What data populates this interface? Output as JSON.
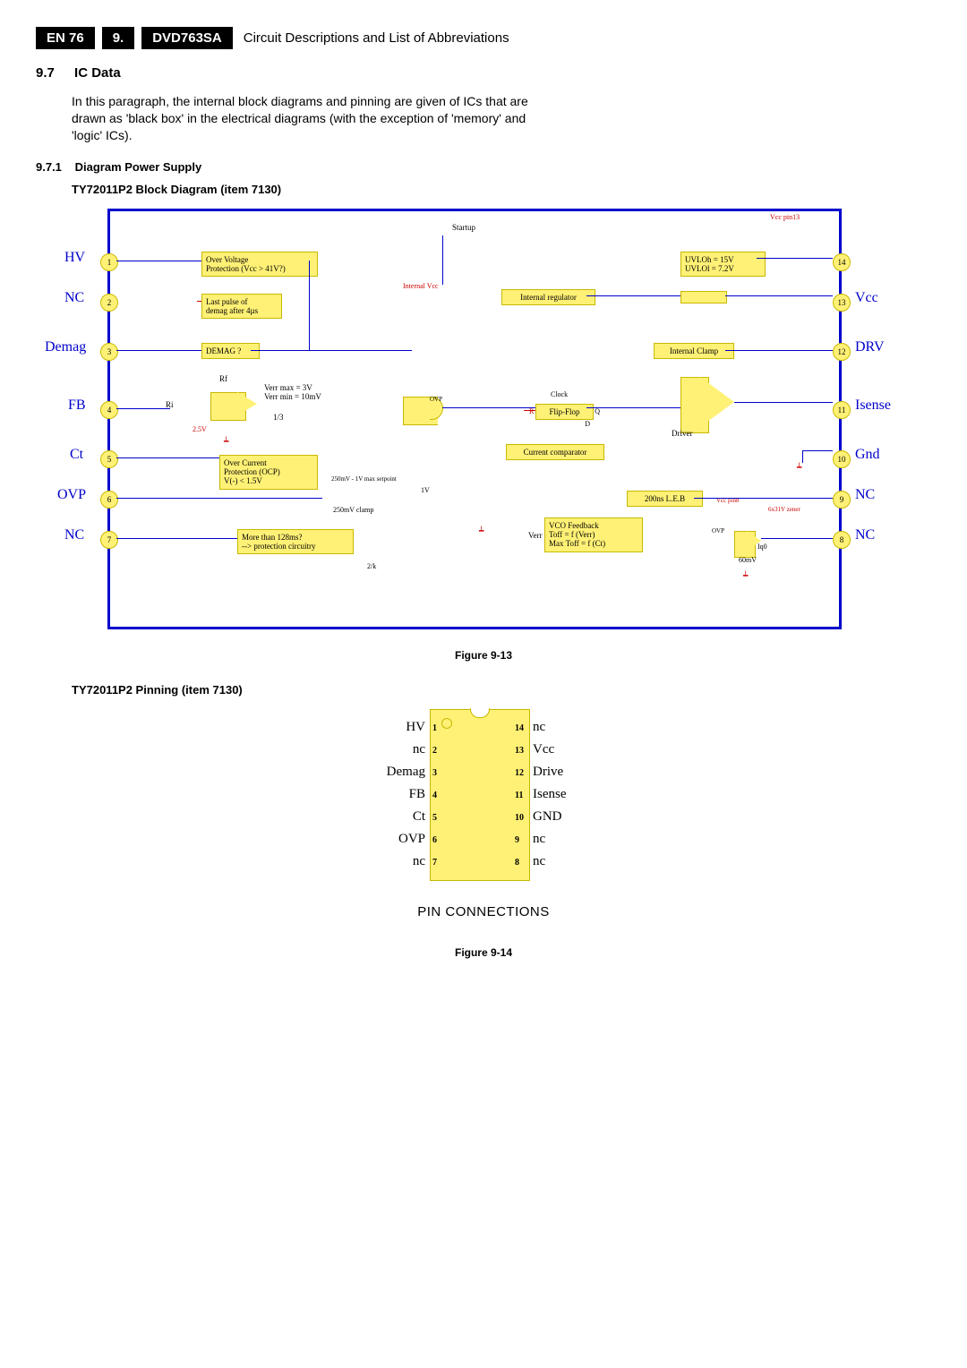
{
  "header": {
    "en": "EN 76",
    "chapnum": "9.",
    "model": "DVD763SA",
    "desc": "Circuit Descriptions and List of Abbreviations"
  },
  "section": {
    "num": "9.7",
    "title": "IC Data"
  },
  "paragraph": "In this paragraph, the internal block diagrams and pinning are given of ICs that are drawn as 'black box' in the electrical diagrams (with the exception of 'memory' and 'logic' ICs).",
  "sub1": {
    "num": "9.7.1",
    "title": "Diagram Power Supply"
  },
  "blocktitle": "TY72011P2 Block Diagram (item 7130)",
  "figure1": "Figure 9-13",
  "pinningtitle": "TY72011P2 Pinning (item 7130)",
  "figure2": "Figure 9-14",
  "d1": {
    "leftpins": [
      {
        "n": "1",
        "label": "HV"
      },
      {
        "n": "2",
        "label": "NC"
      },
      {
        "n": "3",
        "label": "Demag"
      },
      {
        "n": "4",
        "label": "FB"
      },
      {
        "n": "5",
        "label": "Ct"
      },
      {
        "n": "6",
        "label": "OVP"
      },
      {
        "n": "7",
        "label": "NC"
      }
    ],
    "rightpins": [
      {
        "n": "14",
        "label": ""
      },
      {
        "n": "13",
        "label": "Vcc"
      },
      {
        "n": "12",
        "label": "DRV"
      },
      {
        "n": "11",
        "label": "Isense"
      },
      {
        "n": "10",
        "label": "Gnd"
      },
      {
        "n": "9",
        "label": "NC"
      },
      {
        "n": "8",
        "label": "NC"
      }
    ],
    "boxes": {
      "ovp": "Over Voltage\nProtection (Vcc > 41V?)",
      "last": "Last pulse of\ndemag after 4µs",
      "demag": "DEMAG ?",
      "ocp": "Over Current\nProtection (OCP)\nV(-) < 1.5V",
      "more": "More than 128ms?\n--> protection circuitry",
      "intreg": "Internal regulator",
      "intclamp": "Internal Clamp",
      "uvlo": "UVLOh = 15V\nUVLOl = 7.2V",
      "ff": "Flip-Flop",
      "curcomp": "Current comparator",
      "leb": "200ns L.E.B",
      "vco": "VCO Feedback\nToff = f (Verr)\nMax Toff = f (Ct)",
      "driver": "Driver",
      "startup": "Startup",
      "verr": "Verr max = 3V\nVerr min = 10mV",
      "thirds": "1/3",
      "clock": "Clock",
      "rf": "Rf",
      "ri": "Ri",
      "v25": "2.5V",
      "intvcc": "Internal Vcc",
      "vccpin13": "Vcc pin13",
      "vccpin8": "Vcc pin8",
      "clamp250": "250mV clamp",
      "setp": "250mV - 1V max setpoint",
      "zener631": "6x31V zener",
      "iq0": "Iq0",
      "sixtymv": "60mV",
      "twok": "2/k",
      "onev": "1V",
      "verrlbl": "Verr",
      "ovpabbr": "OVP",
      "r_label": "R",
      "q_label": "Q",
      "d_label": "D"
    }
  },
  "d2": {
    "left": [
      {
        "n": "1",
        "label": "HV"
      },
      {
        "n": "2",
        "label": "nc"
      },
      {
        "n": "3",
        "label": "Demag"
      },
      {
        "n": "4",
        "label": "FB"
      },
      {
        "n": "5",
        "label": "Ct"
      },
      {
        "n": "6",
        "label": "OVP"
      },
      {
        "n": "7",
        "label": "nc"
      }
    ],
    "right": [
      {
        "n": "14",
        "label": "nc"
      },
      {
        "n": "13",
        "label": "Vcc"
      },
      {
        "n": "12",
        "label": "Drive"
      },
      {
        "n": "11",
        "label": "Isense"
      },
      {
        "n": "10",
        "label": "GND"
      },
      {
        "n": "9",
        "label": "nc"
      },
      {
        "n": "8",
        "label": "nc"
      }
    ],
    "caption": "PIN CONNECTIONS"
  }
}
